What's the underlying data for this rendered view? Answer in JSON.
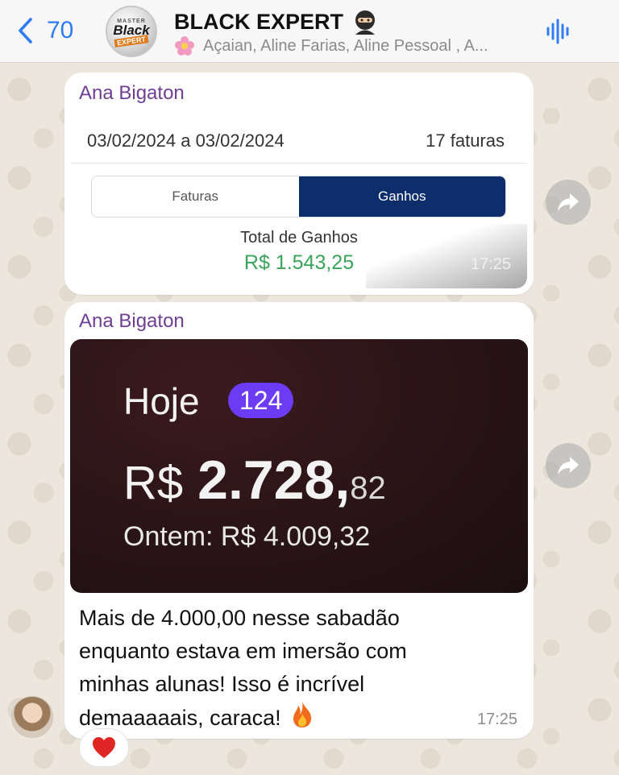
{
  "header": {
    "back_count": "70",
    "group_name": "BLACK EXPERT",
    "group_logo": {
      "top": "MASTER",
      "middle": "Black",
      "bottom": "EXPERT"
    },
    "members": "Açaian, Aline Farias, Aline Pessoal , A..."
  },
  "messages": [
    {
      "sender": "Ana Bigaton",
      "card": {
        "date_range": "03/02/2024 a 03/02/2024",
        "invoices": "17 faturas",
        "tabs": [
          {
            "label": "Faturas",
            "active": false
          },
          {
            "label": "Ganhos",
            "active": true
          }
        ],
        "total_label": "Total de Ganhos",
        "total_value": "R$ 1.543,25"
      },
      "time": "17:25"
    },
    {
      "sender": "Ana Bigaton",
      "image": {
        "today_label": "Hoje",
        "today_badge": "124",
        "currency": "R$",
        "amount_int": "2.728,",
        "amount_dec": "82",
        "yesterday": "Ontem: R$ 4.009,32"
      },
      "text_lines": [
        "Mais de 4.000,00 nesse sabadão",
        "enquanto estava em imersão com",
        "minhas alunas! Isso é incrível",
        "demaaaaais, caraca!"
      ],
      "time": "17:25",
      "reaction": "heart-icon"
    }
  ],
  "colors": {
    "accent_blue": "#2f7cf6",
    "sender_purple": "#6f3e95",
    "tab_active": "#0d2d6b",
    "money_green": "#3aa55a",
    "badge_purple": "#6c3cf5"
  }
}
